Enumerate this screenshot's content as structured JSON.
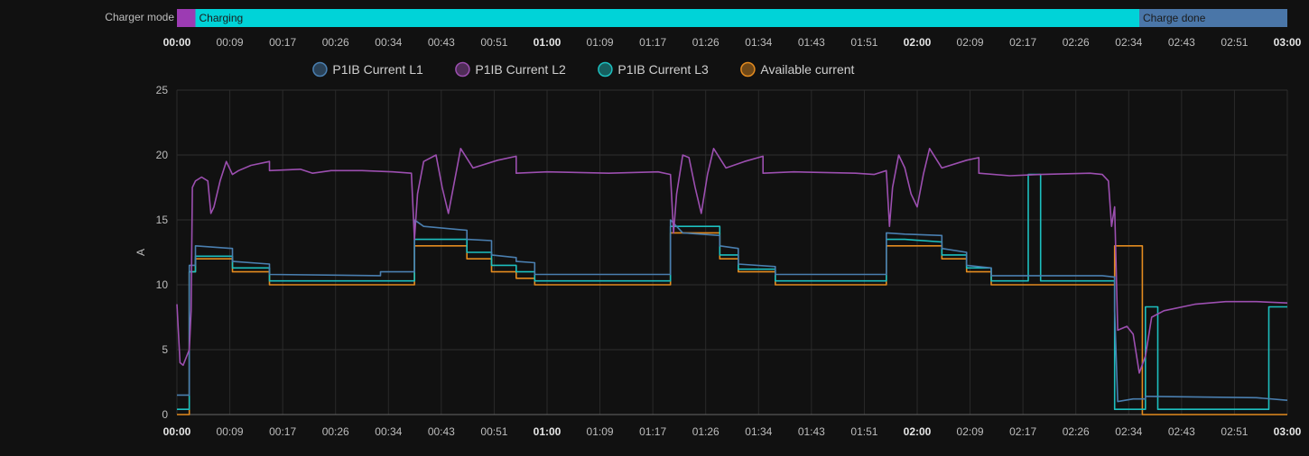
{
  "timeline": {
    "label": "Charger mode",
    "segments": [
      {
        "start": 0,
        "end": 3,
        "label": "",
        "color": "#9c3bb3"
      },
      {
        "start": 3,
        "end": 156,
        "label": "Charging",
        "color": "#00d3d8"
      },
      {
        "start": 156,
        "end": 180,
        "label": "Charge done",
        "color": "#4a76a8"
      }
    ],
    "ticks": [
      "00:00",
      "00:09",
      "00:17",
      "00:26",
      "00:34",
      "00:43",
      "00:51",
      "01:00",
      "01:09",
      "01:17",
      "01:26",
      "01:34",
      "01:43",
      "01:51",
      "02:00",
      "02:09",
      "02:17",
      "02:26",
      "02:34",
      "02:43",
      "02:51",
      "03:00"
    ],
    "bold_ticks": [
      "00:00",
      "01:00",
      "02:00",
      "03:00"
    ]
  },
  "chart_data": {
    "type": "line",
    "title": "",
    "xlabel": "",
    "ylabel": "A",
    "x_unit": "minutes",
    "xlim": [
      0,
      180
    ],
    "ylim": [
      0,
      25
    ],
    "yticks": [
      0,
      5,
      10,
      15,
      20,
      25
    ],
    "xticks": [
      "00:00",
      "00:09",
      "00:17",
      "00:26",
      "00:34",
      "00:43",
      "00:51",
      "01:00",
      "01:09",
      "01:17",
      "01:26",
      "01:34",
      "01:43",
      "01:51",
      "02:00",
      "02:09",
      "02:17",
      "02:26",
      "02:34",
      "02:43",
      "02:51",
      "03:00"
    ],
    "bold_xticks": [
      "00:00",
      "01:00",
      "02:00",
      "03:00"
    ],
    "grid": true,
    "legend_position": "top-center",
    "series": [
      {
        "name": "P1IB Current L1",
        "color": "#4a7fb0",
        "points": [
          [
            0,
            1.5
          ],
          [
            2,
            1.5
          ],
          [
            2,
            11.5
          ],
          [
            3,
            11.5
          ],
          [
            3,
            13
          ],
          [
            9,
            12.8
          ],
          [
            9,
            11.8
          ],
          [
            15,
            11.6
          ],
          [
            15,
            10.8
          ],
          [
            33,
            10.7
          ],
          [
            33,
            11
          ],
          [
            38.5,
            11
          ],
          [
            38.5,
            15
          ],
          [
            40,
            14.5
          ],
          [
            47,
            14.2
          ],
          [
            47,
            13.5
          ],
          [
            51,
            13.4
          ],
          [
            51,
            12.3
          ],
          [
            55,
            12.1
          ],
          [
            55,
            11.8
          ],
          [
            58,
            11.7
          ],
          [
            58,
            10.8
          ],
          [
            80,
            10.8
          ],
          [
            80,
            15
          ],
          [
            82,
            14
          ],
          [
            88,
            13.8
          ],
          [
            88,
            13
          ],
          [
            91,
            12.8
          ],
          [
            91,
            11.6
          ],
          [
            97,
            11.4
          ],
          [
            97,
            10.8
          ],
          [
            115,
            10.8
          ],
          [
            115,
            14
          ],
          [
            118,
            13.9
          ],
          [
            124,
            13.8
          ],
          [
            124,
            12.8
          ],
          [
            128,
            12.5
          ],
          [
            128,
            11.5
          ],
          [
            132,
            11.3
          ],
          [
            132,
            10.7
          ],
          [
            150,
            10.7
          ],
          [
            152,
            10.6
          ],
          [
            152,
            8
          ],
          [
            152.5,
            1
          ],
          [
            155,
            1.2
          ],
          [
            157,
            1.2
          ],
          [
            157,
            1.4
          ],
          [
            175,
            1.3
          ],
          [
            180,
            1.1
          ]
        ]
      },
      {
        "name": "P1IB Current L2",
        "color": "#9c4fb0",
        "points": [
          [
            0,
            8.5
          ],
          [
            0.5,
            4
          ],
          [
            1,
            3.8
          ],
          [
            2,
            5
          ],
          [
            2.3,
            8
          ],
          [
            2.5,
            17.5
          ],
          [
            3,
            18
          ],
          [
            4,
            18.3
          ],
          [
            5,
            18
          ],
          [
            5.5,
            15.5
          ],
          [
            6,
            16
          ],
          [
            7,
            18
          ],
          [
            8,
            19.5
          ],
          [
            9,
            18.5
          ],
          [
            10,
            18.8
          ],
          [
            12,
            19.2
          ],
          [
            15,
            19.5
          ],
          [
            15,
            18.8
          ],
          [
            20,
            18.9
          ],
          [
            22,
            18.6
          ],
          [
            25,
            18.8
          ],
          [
            30,
            18.8
          ],
          [
            35,
            18.7
          ],
          [
            38,
            18.6
          ],
          [
            38.5,
            13.5
          ],
          [
            39,
            17
          ],
          [
            40,
            19.5
          ],
          [
            42,
            20
          ],
          [
            43,
            17.5
          ],
          [
            44,
            15.5
          ],
          [
            45,
            18
          ],
          [
            46,
            20.5
          ],
          [
            48,
            19
          ],
          [
            52,
            19.6
          ],
          [
            55,
            19.9
          ],
          [
            55,
            18.6
          ],
          [
            60,
            18.7
          ],
          [
            70,
            18.6
          ],
          [
            78,
            18.7
          ],
          [
            80,
            18.5
          ],
          [
            80.5,
            14
          ],
          [
            81,
            17
          ],
          [
            82,
            20
          ],
          [
            83,
            19.8
          ],
          [
            84,
            17.5
          ],
          [
            85,
            15.5
          ],
          [
            86,
            18.5
          ],
          [
            87,
            20.5
          ],
          [
            89,
            19
          ],
          [
            92,
            19.5
          ],
          [
            95,
            19.9
          ],
          [
            95,
            18.6
          ],
          [
            100,
            18.7
          ],
          [
            110,
            18.6
          ],
          [
            113,
            18.5
          ],
          [
            115,
            18.8
          ],
          [
            115.5,
            14.5
          ],
          [
            116,
            17.5
          ],
          [
            117,
            20
          ],
          [
            118,
            19
          ],
          [
            119,
            17
          ],
          [
            120,
            16
          ],
          [
            121,
            18.5
          ],
          [
            122,
            20.5
          ],
          [
            124,
            19
          ],
          [
            128,
            19.6
          ],
          [
            130,
            19.8
          ],
          [
            130,
            18.6
          ],
          [
            135,
            18.4
          ],
          [
            140,
            18.5
          ],
          [
            148,
            18.6
          ],
          [
            150,
            18.5
          ],
          [
            151,
            18
          ],
          [
            151.5,
            14.5
          ],
          [
            152,
            16
          ],
          [
            152.5,
            6.5
          ],
          [
            154,
            6.8
          ],
          [
            155,
            6.2
          ],
          [
            156,
            3.2
          ],
          [
            157,
            4.5
          ],
          [
            158,
            7.5
          ],
          [
            160,
            8
          ],
          [
            165,
            8.5
          ],
          [
            170,
            8.7
          ],
          [
            175,
            8.7
          ],
          [
            180,
            8.6
          ]
        ]
      },
      {
        "name": "P1IB Current L3",
        "color": "#1dbfbf",
        "points": [
          [
            0,
            0.4
          ],
          [
            2,
            0.4
          ],
          [
            2,
            11
          ],
          [
            3,
            11
          ],
          [
            3,
            12.2
          ],
          [
            9,
            12.2
          ],
          [
            9,
            11.3
          ],
          [
            15,
            11.3
          ],
          [
            15,
            10.3
          ],
          [
            38.5,
            10.3
          ],
          [
            38.5,
            13.5
          ],
          [
            47,
            13.5
          ],
          [
            47,
            12.5
          ],
          [
            51,
            12.5
          ],
          [
            51,
            11.5
          ],
          [
            55,
            11.5
          ],
          [
            55,
            11
          ],
          [
            58,
            11
          ],
          [
            58,
            10.3
          ],
          [
            80,
            10.3
          ],
          [
            80,
            14.5
          ],
          [
            88,
            14.5
          ],
          [
            88,
            12.3
          ],
          [
            91,
            12.3
          ],
          [
            91,
            11.2
          ],
          [
            97,
            11.2
          ],
          [
            97,
            10.3
          ],
          [
            115,
            10.3
          ],
          [
            115,
            13.5
          ],
          [
            118,
            13.5
          ],
          [
            124,
            13.3
          ],
          [
            124,
            12.3
          ],
          [
            128,
            12.3
          ],
          [
            128,
            11.3
          ],
          [
            132,
            11.3
          ],
          [
            132,
            10.3
          ],
          [
            138,
            10.3
          ],
          [
            138,
            18.5
          ],
          [
            140,
            18.5
          ],
          [
            140,
            10.3
          ],
          [
            152,
            10.3
          ],
          [
            152,
            0.4
          ],
          [
            157,
            0.4
          ],
          [
            157,
            8.3
          ],
          [
            159,
            8.3
          ],
          [
            159,
            0.4
          ],
          [
            177,
            0.4
          ],
          [
            177,
            8.3
          ],
          [
            180,
            8.3
          ]
        ]
      },
      {
        "name": "Available current",
        "color": "#e38b1f",
        "points": [
          [
            0,
            0
          ],
          [
            2,
            0
          ],
          [
            2,
            11
          ],
          [
            3,
            11
          ],
          [
            3,
            12
          ],
          [
            9,
            12
          ],
          [
            9,
            11
          ],
          [
            15,
            11
          ],
          [
            15,
            10
          ],
          [
            38.5,
            10
          ],
          [
            38.5,
            13
          ],
          [
            47,
            13
          ],
          [
            47,
            12
          ],
          [
            51,
            12
          ],
          [
            51,
            11
          ],
          [
            55,
            11
          ],
          [
            55,
            10.5
          ],
          [
            58,
            10.5
          ],
          [
            58,
            10
          ],
          [
            80,
            10
          ],
          [
            80,
            14
          ],
          [
            88,
            14
          ],
          [
            88,
            12
          ],
          [
            91,
            12
          ],
          [
            91,
            11
          ],
          [
            97,
            11
          ],
          [
            97,
            10
          ],
          [
            115,
            10
          ],
          [
            115,
            13
          ],
          [
            124,
            13
          ],
          [
            124,
            12
          ],
          [
            128,
            12
          ],
          [
            128,
            11
          ],
          [
            132,
            11
          ],
          [
            132,
            10
          ],
          [
            152,
            10
          ],
          [
            152,
            13
          ],
          [
            156.5,
            13
          ],
          [
            156.5,
            0
          ],
          [
            180,
            0
          ]
        ]
      }
    ]
  }
}
